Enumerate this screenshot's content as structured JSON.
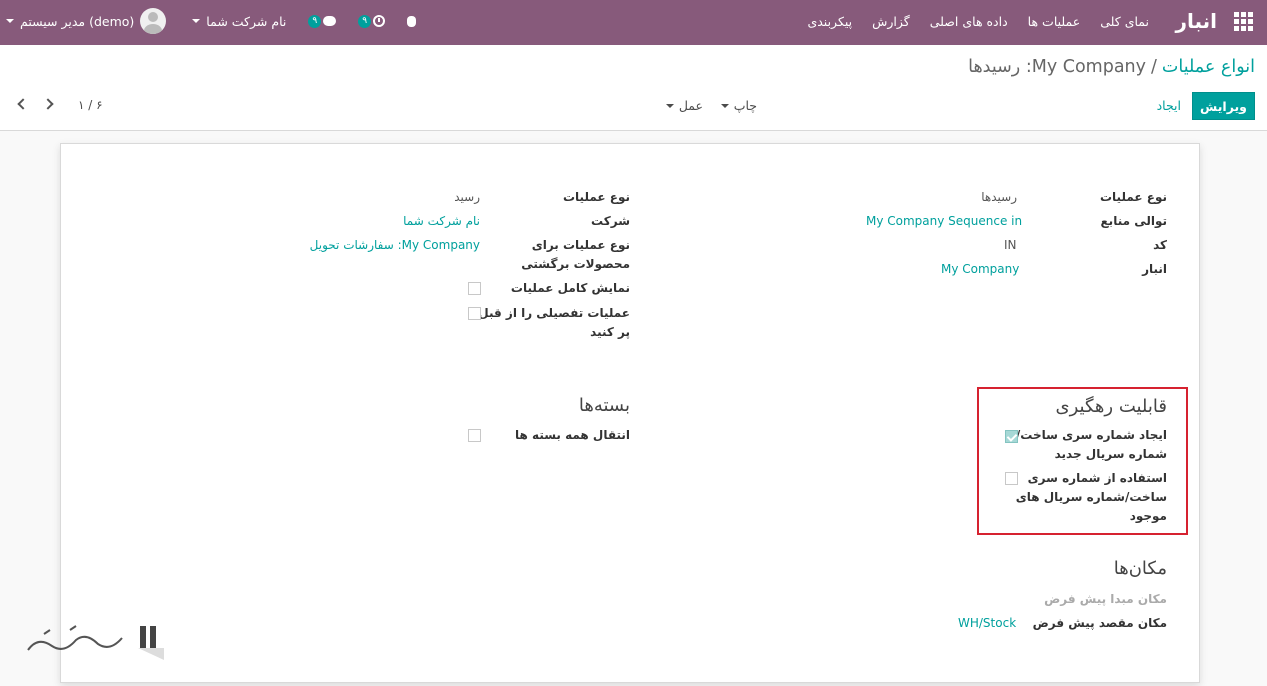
{
  "navbar": {
    "app_title": "انبار",
    "menu": [
      "نمای کلی",
      "عملیات ها",
      "داده های اصلی",
      "گزارش",
      "پیکربندی"
    ],
    "user_name": "مدیر سیستم (demo)",
    "company": "نام شرکت شما",
    "messages_badge": "۹",
    "activities_badge": "۹",
    "bg_color": "#875a7b"
  },
  "breadcrumb": {
    "parent": "انواع عملیات",
    "separator": "/",
    "current": "My Company: رسیدها"
  },
  "control": {
    "edit": "ویرایش",
    "create": "ایجاد",
    "print": "چاپ",
    "action": "عمل",
    "pager": "۱ / ۶"
  },
  "form": {
    "right": {
      "op_type_label": "نوع عملیات",
      "op_type_value": "رسیدها",
      "sequence_label": "توالی منابع",
      "sequence_value": "My Company Sequence in",
      "code_label": "کد",
      "code_value": "IN",
      "warehouse_label": "انبار",
      "warehouse_value": "My Company"
    },
    "left": {
      "type_label": "نوع عملیات",
      "type_value": "رسید",
      "company_label": "شرکت",
      "company_value": "نام شرکت شما",
      "return_label_1": "نوع عملیات برای",
      "return_label_2": "محصولات برگشتی",
      "return_value": "My Company: سفارشات تحویل",
      "show_ops_label": "نمایش کامل عملیات",
      "show_ops_checked": false,
      "prefill_label_1": "عملیات تفصیلی را از قبل",
      "prefill_label_2": "پر کنید",
      "prefill_checked": false
    },
    "traceability": {
      "title": "قابلیت رهگیری",
      "create_lots_1": "ایجاد شماره سری ساخت/",
      "create_lots_2": "شماره سریال جدید",
      "create_lots_checked": true,
      "use_existing_1": "استفاده از شماره سری",
      "use_existing_2": "ساخت/شماره سریال های",
      "use_existing_3": "موجود",
      "use_existing_checked": false
    },
    "packages": {
      "title": "بسته‌ها",
      "move_all_label": "انتقال همه بسته ها",
      "move_all_checked": false
    },
    "locations": {
      "title": "مکان‌ها",
      "src_label": "مکان مبدا پیش فرض",
      "dest_label": "مکان مقصد پیش فرض",
      "dest_value": "WH/Stock"
    }
  },
  "colors": {
    "accent": "#00a09d",
    "highlight": "#d62230"
  }
}
